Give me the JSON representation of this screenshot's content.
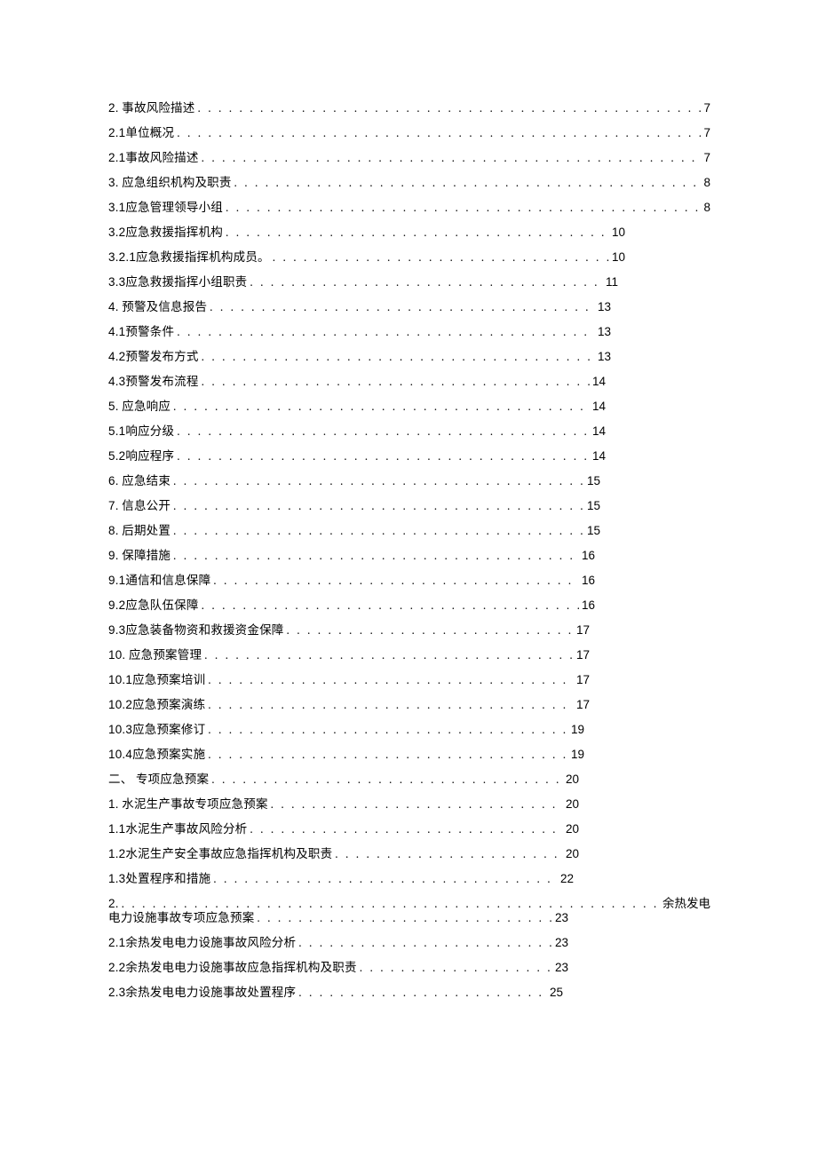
{
  "toc": [
    {
      "label": "2. 事故风险描述",
      "page": "7",
      "wclass": "w0"
    },
    {
      "label": "2.1单位概况",
      "page": "7",
      "wclass": "w0"
    },
    {
      "label": "2.1事故风险描述",
      "page": "7",
      "wclass": "w0"
    },
    {
      "label": "3. 应急组织机构及职责",
      "page": "8",
      "wclass": "w0"
    },
    {
      "label": "3.1应急管理领导小组",
      "page": "8",
      "wclass": "w0"
    },
    {
      "label": "3.2应急救援指挥机构",
      "page": "10",
      "wclass": "w1"
    },
    {
      "label": "3.2.1应急救援指挥机构成员。",
      "page": "10",
      "wclass": "w1"
    },
    {
      "label": "3.3应急救援指挥小组职责",
      "page": "11",
      "wclass": "w2"
    },
    {
      "label": "4. 预警及信息报告",
      "page": "13",
      "wclass": "w3"
    },
    {
      "label": "4.1预警条件",
      "page": "13",
      "wclass": "w3"
    },
    {
      "label": "4.2预警发布方式",
      "page": "13",
      "wclass": "w3"
    },
    {
      "label": "4.3预警发布流程",
      "page": "14",
      "wclass": "w4"
    },
    {
      "label": "5. 应急响应",
      "page": "14",
      "wclass": "w4"
    },
    {
      "label": "5.1响应分级",
      "page": "14",
      "wclass": "w4"
    },
    {
      "label": "5.2响应程序",
      "page": "14",
      "wclass": "w4"
    },
    {
      "label": "6. 应急结束",
      "page": "15",
      "wclass": "w5"
    },
    {
      "label": "7. 信息公开",
      "page": "15",
      "wclass": "w5"
    },
    {
      "label": "8. 后期处置",
      "page": "15",
      "wclass": "w5"
    },
    {
      "label": "9. 保障措施",
      "page": "16",
      "wclass": "w6"
    },
    {
      "label": "9.1通信和信息保障",
      "page": "16",
      "wclass": "w6"
    },
    {
      "label": "9.2应急队伍保障",
      "page": "16",
      "wclass": "w6"
    },
    {
      "label": "9.3应急装备物资和救援资金保障",
      "page": "17",
      "wclass": "w7"
    },
    {
      "label": "10. 应急预案管理",
      "page": "17",
      "wclass": "w7"
    },
    {
      "label": "10.1应急预案培训",
      "page": "17",
      "wclass": "w7"
    },
    {
      "label": "10.2应急预案演练",
      "page": "17",
      "wclass": "w7"
    },
    {
      "label": "10.3应急预案修订",
      "page": "19",
      "wclass": "w8"
    },
    {
      "label": "10.4应急预案实施",
      "page": "19",
      "wclass": "w8"
    },
    {
      "label": "二、 专项应急预案",
      "page": "20",
      "wclass": "w9"
    },
    {
      "label": "1. 水泥生产事故专项应急预案",
      "page": "20",
      "wclass": "w9"
    },
    {
      "label": "1.1水泥生产事故风险分析",
      "page": "20",
      "wclass": "w9"
    },
    {
      "label": "1.2水泥生产安全事故应急指挥机构及职责",
      "page": "20",
      "wclass": "w9"
    },
    {
      "label": "1.3处置程序和措施",
      "page": "22",
      "wclass": "w10"
    },
    {
      "wrap": true,
      "label_top": "2.",
      "tail_top": "余热发电",
      "label_bottom": "电力设施事故专项应急预案",
      "page": "23",
      "wclass_bottom": "w11"
    },
    {
      "label": "2.1余热发电电力设施事故风险分析",
      "page": "23",
      "wclass": "w11"
    },
    {
      "label": "2.2余热发电电力设施事故应急指挥机构及职责",
      "page": "23",
      "wclass": "w11"
    },
    {
      "label": "2.3余热发电电力设施事故处置程序",
      "page": "25",
      "wclass": "w12"
    }
  ]
}
